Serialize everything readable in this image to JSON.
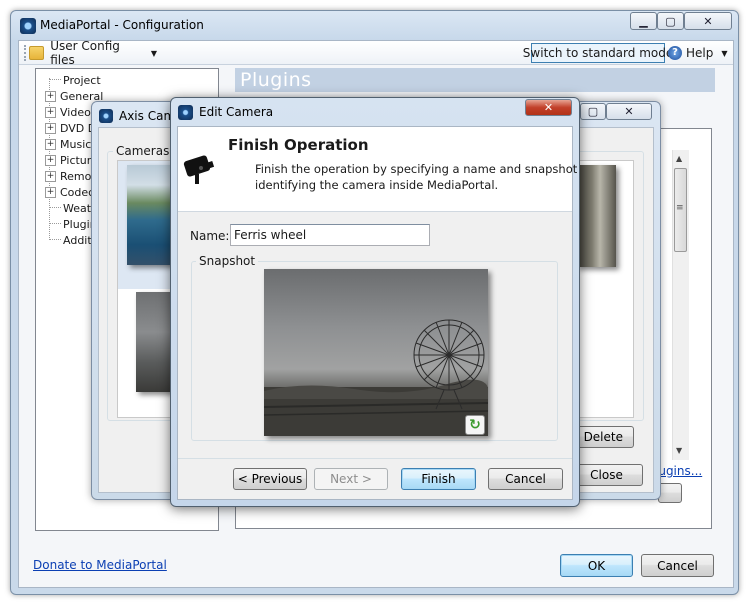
{
  "main_window": {
    "title": "MediaPortal - Configuration",
    "caption_buttons": [
      "minimize",
      "maximize",
      "close"
    ]
  },
  "toolbar": {
    "user_config_label": "User Config files",
    "switch_mode_label": "Switch to standard mode",
    "help_label": "Help"
  },
  "tree": {
    "items": [
      {
        "label": "Project",
        "expandable": false
      },
      {
        "label": "General",
        "expandable": true
      },
      {
        "label": "Videos",
        "expandable": true
      },
      {
        "label": "DVD D",
        "expandable": true
      },
      {
        "label": "Music",
        "expandable": true
      },
      {
        "label": "Picture",
        "expandable": true
      },
      {
        "label": "Remot",
        "expandable": true
      },
      {
        "label": "Codec",
        "expandable": true
      },
      {
        "label": "Weath",
        "expandable": false
      },
      {
        "label": "Plugin",
        "expandable": false
      },
      {
        "label": "Additio",
        "expandable": false
      }
    ]
  },
  "content": {
    "section_title": "Plugins",
    "plugins_link": "lugins..."
  },
  "footer": {
    "donate_link": "Donate to MediaPortal",
    "ok_label": "OK",
    "cancel_label": "Cancel"
  },
  "axis_dialog": {
    "title": "Axis Came",
    "cameras_group": "Cameras",
    "delete_label": "Delete",
    "close_label": "Close"
  },
  "edit_camera": {
    "title": "Edit Camera",
    "heading": "Finish Operation",
    "description_line1": "Finish the operation by specifying a name and snapshot",
    "description_line2": "identifying the camera inside MediaPortal.",
    "name_label": "Name:",
    "name_value": "Ferris wheel",
    "snapshot_group": "Snapshot",
    "buttons": {
      "previous": "< Previous",
      "next": "Next >",
      "finish": "Finish",
      "cancel": "Cancel"
    },
    "next_enabled": false
  },
  "colors": {
    "accent": "#3c7fb1",
    "link": "#0b3fb3",
    "plugins_header_bg": "#c2d1e3",
    "close_button": "#c2402a"
  },
  "icons": {
    "app": "mediaportal-icon",
    "folder": "folder-icon",
    "help": "help-icon",
    "camera": "camera-icon",
    "refresh": "refresh-icon"
  }
}
